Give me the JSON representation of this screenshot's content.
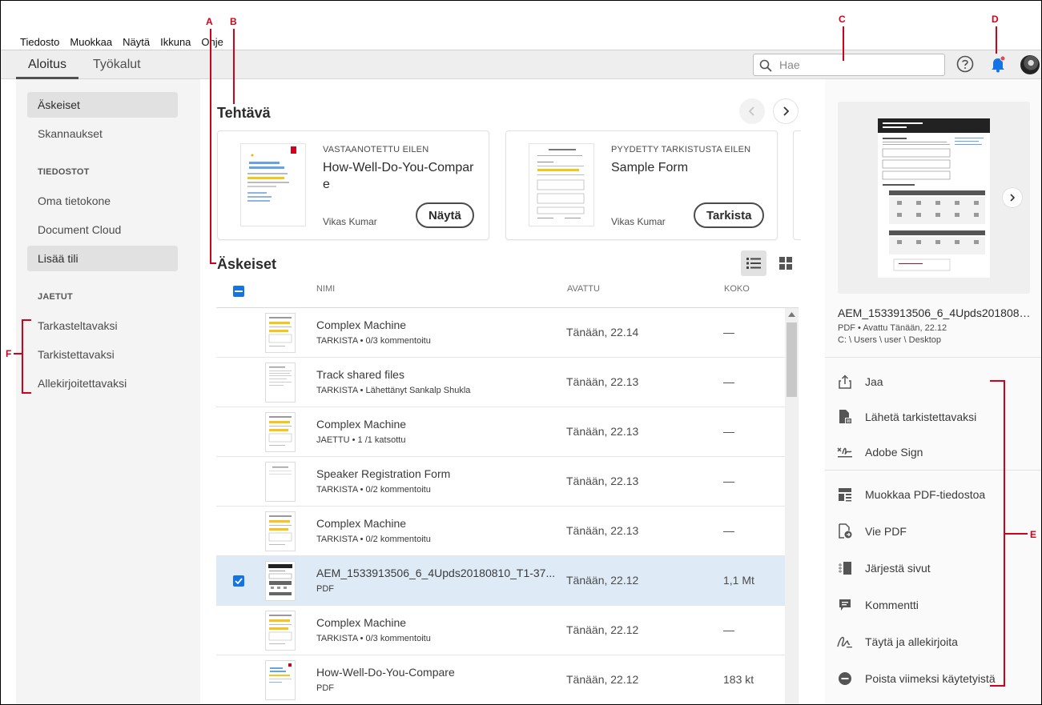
{
  "menu": [
    "Tiedosto",
    "Muokkaa",
    "Näytä",
    "Ikkuna",
    "Ohje"
  ],
  "tabs": {
    "home": "Aloitus",
    "tools": "Työkalut"
  },
  "search": {
    "placeholder": "Hae"
  },
  "sidebar": {
    "recent": "Äskeiset",
    "scans": "Skannaukset",
    "files_header": "TIEDOSTOT",
    "my_computer": "Oma tietokone",
    "document_cloud": "Document Cloud",
    "add_account": "Lisää tili",
    "shared_header": "JAETUT",
    "to_view": "Tarkasteltavaksi",
    "to_review": "Tarkistettavaksi",
    "to_sign": "Allekirjoitettavaksi"
  },
  "tasks": {
    "title": "Tehtävä",
    "cards": [
      {
        "kicker": "VASTAANOTETTU EILEN",
        "title": "How-Well-Do-You-Compare",
        "author": "Vikas Kumar",
        "button": "Näytä"
      },
      {
        "kicker": "PYYDETTY TARKISTUSTA EILEN",
        "title": "Sample Form",
        "author": "Vikas Kumar",
        "button": "Tarkista"
      }
    ]
  },
  "recent": {
    "title": "Äskeiset",
    "columns": {
      "name": "NIMI",
      "opened": "AVATTU",
      "size": "KOKO"
    },
    "rows": [
      {
        "name": "Complex Machine",
        "sub": "TARKISTA  •  0/3 kommentoitu",
        "opened": "Tänään, 22.14",
        "size": "—"
      },
      {
        "name": "Track shared files",
        "sub": "TARKISTA  •  Lähettänyt Sankalp Shukla",
        "opened": "Tänään, 22.13",
        "size": "—"
      },
      {
        "name": "Complex Machine",
        "sub": "JAETTU  •  1 /1 katsottu",
        "opened": "Tänään, 22.13",
        "size": "—"
      },
      {
        "name": "Speaker Registration Form",
        "sub": "TARKISTA  •  0/2 kommentoitu",
        "opened": "Tänään, 22.13",
        "size": "—"
      },
      {
        "name": "Complex Machine",
        "sub": "TARKISTA  •  0/2 kommentoitu",
        "opened": "Tänään, 22.13",
        "size": "—"
      },
      {
        "name": "AEM_1533913506_6_4Upds20180810_T1-37...",
        "sub": "PDF",
        "opened": "Tänään, 22.12",
        "size": "1,1 Mt",
        "selected": true
      },
      {
        "name": "Complex Machine",
        "sub": "TARKISTA  •  0/3 kommentoitu",
        "opened": "Tänään, 22.12",
        "size": "—"
      },
      {
        "name": "How-Well-Do-You-Compare",
        "sub": "PDF",
        "opened": "Tänään, 22.12",
        "size": "183 kt"
      }
    ]
  },
  "details": {
    "file_name": "AEM_1533913506_6_4Upds2018081...",
    "meta": "PDF  •  Avattu Tänään, 22.12",
    "path": "C: \\ Users \\ user \\ Desktop",
    "actions": [
      "Jaa",
      "Lähetä tarkistettavaksi",
      "Adobe Sign",
      "Muokkaa PDF-tiedostoa",
      "Vie PDF",
      "Järjestä sivut",
      "Kommentti",
      "Täytä ja allekirjoita",
      "Poista viimeksi käytetyistä"
    ]
  },
  "annotations": {
    "a": "A",
    "b": "B",
    "c": "C",
    "d": "D",
    "e": "E",
    "f": "F"
  },
  "colors": {
    "accent": "#1473e6",
    "annotation": "#d0021b",
    "notification": "#e34850",
    "bell": "#1473e6"
  }
}
